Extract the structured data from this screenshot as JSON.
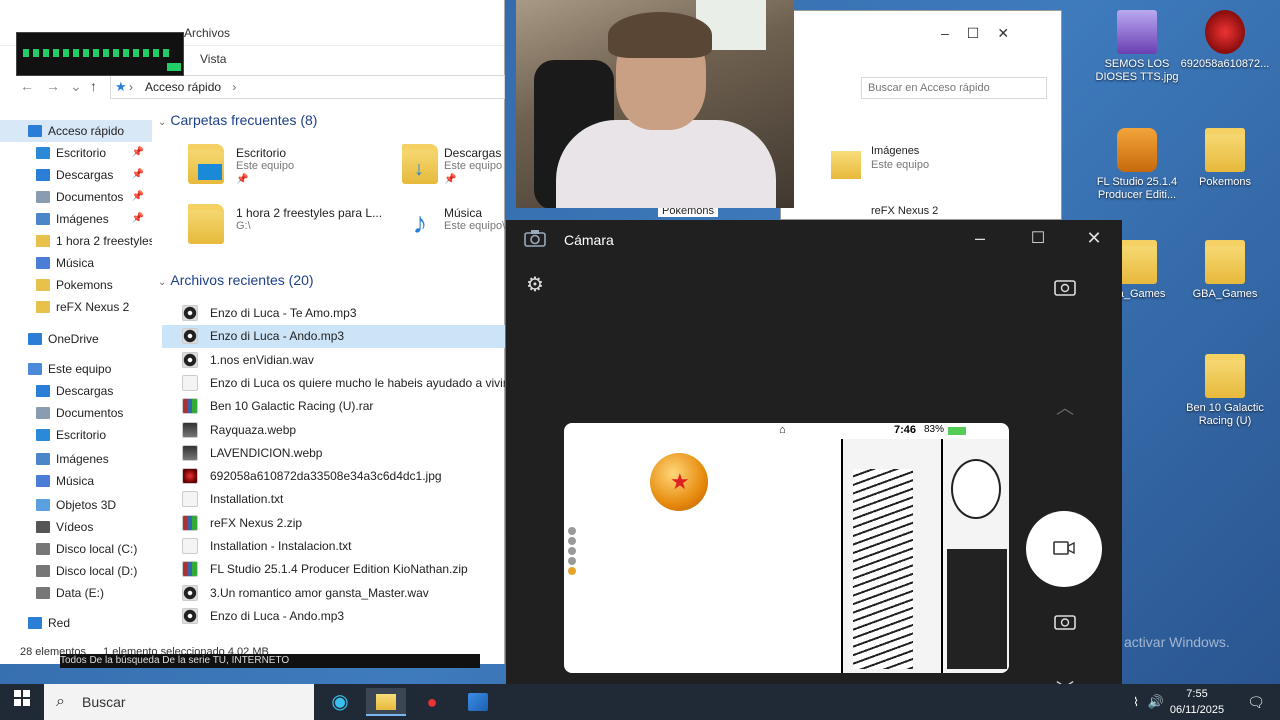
{
  "desktop": {
    "icons": [
      {
        "label": "SEMOS LOS DIOSES TTS.jpg"
      },
      {
        "label": "692058a610872..."
      },
      {
        "label": "FL Studio 25.1.4 Producer Editi..."
      },
      {
        "label": "Pokemons"
      },
      {
        "label": "...a_Games"
      },
      {
        "label": "GBA_Games"
      },
      {
        "label": "Ben 10 Galactic Racing (U)"
      }
    ],
    "watermark": "activar Windows."
  },
  "explorer": {
    "title": "Archivos",
    "ribbon_tab": "Vista",
    "address": "Acceso rápido",
    "search_placeholder": "Buscar en Acceso rápido",
    "sidebar": [
      {
        "label": "Acceso rápido",
        "icon": "star-icon"
      },
      {
        "label": "Escritorio",
        "icon": "desktop-icon"
      },
      {
        "label": "Descargas",
        "icon": "download-icon"
      },
      {
        "label": "Documentos",
        "icon": "document-icon"
      },
      {
        "label": "Imágenes",
        "icon": "image-icon"
      },
      {
        "label": "1 hora 2 freestyles",
        "icon": "folder-icon"
      },
      {
        "label": "Música",
        "icon": "music-icon"
      },
      {
        "label": "Pokemons",
        "icon": "folder-icon"
      },
      {
        "label": "reFX Nexus 2",
        "icon": "folder-icon"
      },
      {
        "label": "OneDrive",
        "icon": "cloud-icon"
      },
      {
        "label": "Este equipo",
        "icon": "pc-icon"
      },
      {
        "label": "Descargas",
        "icon": "download-icon"
      },
      {
        "label": "Documentos",
        "icon": "document-icon"
      },
      {
        "label": "Escritorio",
        "icon": "desktop-icon"
      },
      {
        "label": "Imágenes",
        "icon": "image-icon"
      },
      {
        "label": "Música",
        "icon": "music-icon"
      },
      {
        "label": "Objetos 3D",
        "icon": "cube-icon"
      },
      {
        "label": "Vídeos",
        "icon": "video-icon"
      },
      {
        "label": "Disco local (C:)",
        "icon": "drive-icon"
      },
      {
        "label": "Disco local (D:)",
        "icon": "drive-icon"
      },
      {
        "label": "Data (E:)",
        "icon": "drive-icon"
      },
      {
        "label": "Red",
        "icon": "network-icon"
      }
    ],
    "frequent_title": "Carpetas frecuentes (8)",
    "frequent": [
      {
        "name": "Escritorio",
        "sub": "Este equipo"
      },
      {
        "name": "Descargas",
        "sub": "Este equipo"
      },
      {
        "name": "1 hora 2 freestyles para L...",
        "sub": "G:\\"
      },
      {
        "name": "Música",
        "sub": "Este equipo\\"
      }
    ],
    "recent_title": "Archivos recientes (20)",
    "recent": [
      {
        "name": "Enzo di Luca - Te Amo.mp3"
      },
      {
        "name": "Enzo di Luca - Ando.mp3"
      },
      {
        "name": "1.nos enVidian.wav"
      },
      {
        "name": "Enzo di Luca os quiere mucho le habeis ayudado a vivir.txt"
      },
      {
        "name": "Ben 10 Galactic Racing (U).rar"
      },
      {
        "name": "Rayquaza.webp"
      },
      {
        "name": "LAVENDICION.webp"
      },
      {
        "name": "692058a610872da33508e34a3c6d4dc1.jpg"
      },
      {
        "name": "Installation.txt"
      },
      {
        "name": "reFX Nexus 2.zip"
      },
      {
        "name": "Installation - Instalacion.txt"
      },
      {
        "name": "FL Studio 25.1.4 Producer Edition KioNathan.zip"
      },
      {
        "name": "3.Un romantico amor gansta_Master.wav"
      },
      {
        "name": "Enzo di Luca - Ando.mp3"
      }
    ],
    "status_count": "28 elementos",
    "status_selected": "1 elemento seleccionado  4,02 MB"
  },
  "explorer_back": {
    "search_placeholder": "Buscar en Acceso rápido",
    "items": [
      "Imágenes",
      "Este equipo",
      "reFX Nexus 2",
      "Pokemons"
    ]
  },
  "behind_strip": "Todos    De la búsqueda    De la serie    TU, INTERNETO",
  "camera": {
    "title": "Cámara",
    "preview_time": "7:46",
    "preview_battery": "83%"
  },
  "taskbar": {
    "search_label": "Buscar",
    "time": "7:55",
    "date": "06/11/2025"
  }
}
